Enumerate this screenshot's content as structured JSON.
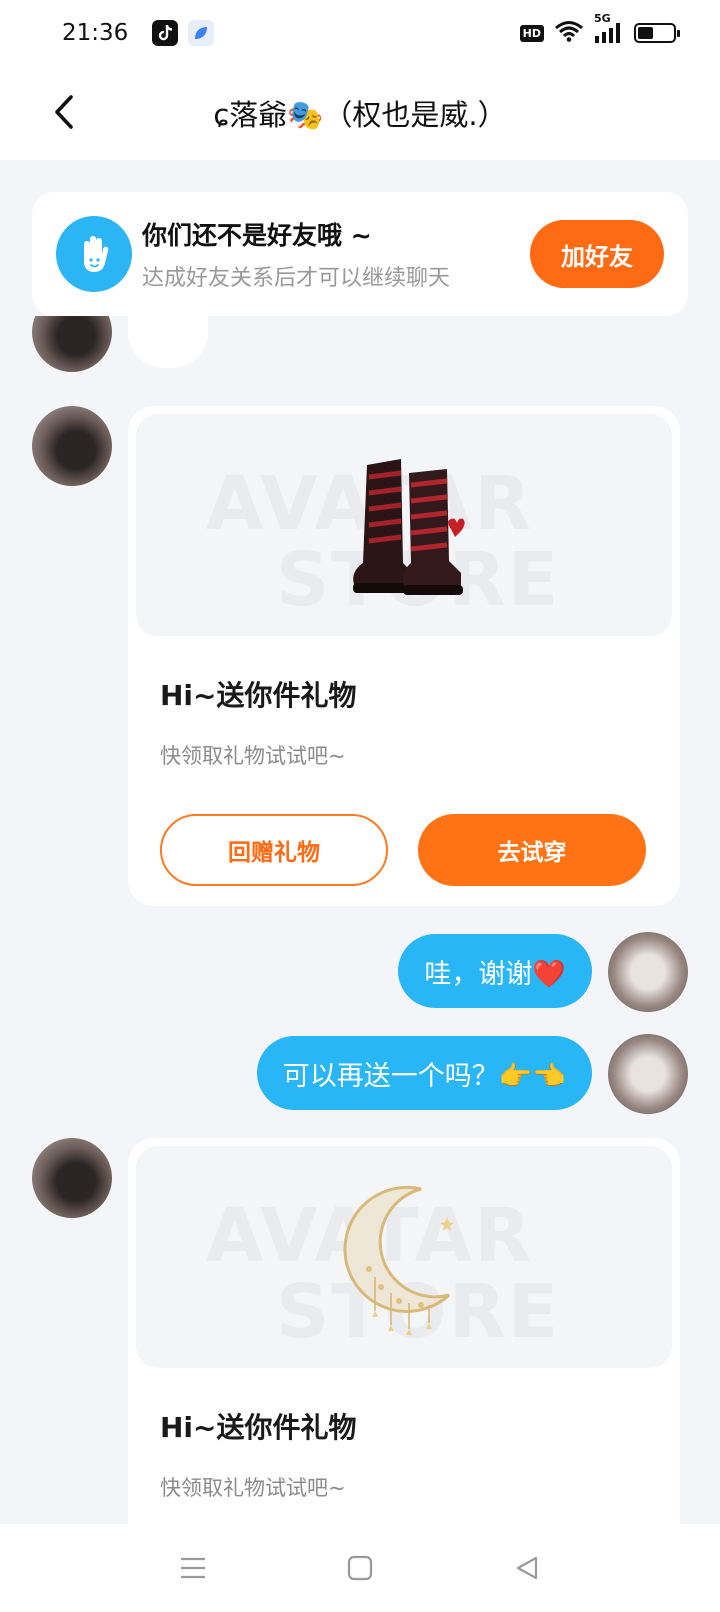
{
  "status_bar": {
    "time": "21:36",
    "hd": "HD",
    "network": "5G",
    "battery_level": 0.45
  },
  "header": {
    "title": "ɕ落爺🎭（权也是威.）",
    "back_icon": "chevron-left-icon"
  },
  "friend_banner": {
    "title": "你们还不是好友哦 ~",
    "subtitle": "达成好友关系后才可以继续聊天",
    "button": "加好友",
    "icon": "hand-wave-icon"
  },
  "messages": [
    {
      "type": "gift",
      "sender": "other",
      "image": "boots",
      "watermark": [
        "AVATAR",
        "STORE"
      ],
      "title": "Hi~送你件礼物",
      "subtitle": "快领取礼物试试吧~",
      "return_button": "回赠礼物",
      "try_button": "去试穿"
    },
    {
      "type": "text",
      "sender": "self",
      "text": "哇，谢谢❤️"
    },
    {
      "type": "text",
      "sender": "self",
      "text": "可以再送一个吗？👉👈"
    },
    {
      "type": "gift",
      "sender": "other",
      "image": "moon",
      "watermark": [
        "AVATAR",
        "STORE"
      ],
      "title": "Hi~送你件礼物",
      "subtitle": "快领取礼物试试吧~"
    }
  ],
  "colors": {
    "accent_orange": "#ff6a13",
    "bubble_blue": "#29b6f6",
    "background": "#f3f5f8"
  }
}
